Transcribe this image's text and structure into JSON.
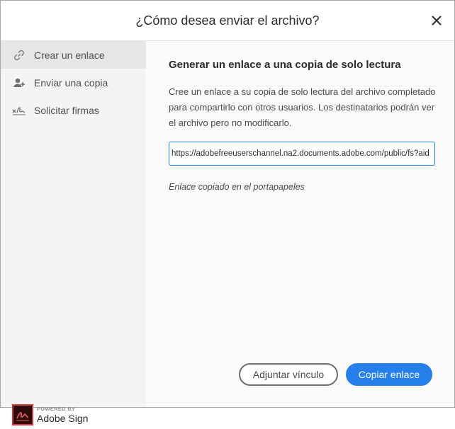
{
  "dialog": {
    "title": "¿Cómo desea enviar el archivo?",
    "close_icon": "close-icon"
  },
  "sidebar": {
    "items": [
      {
        "label": "Crear un enlace",
        "icon": "link-icon",
        "active": true
      },
      {
        "label": "Enviar una copia",
        "icon": "add-person-icon",
        "active": false
      },
      {
        "label": "Solicitar firmas",
        "icon": "signature-icon",
        "active": false
      }
    ]
  },
  "main": {
    "heading": "Generar un enlace a una copia de solo lectura",
    "description": "Cree un enlace a su copia de solo lectura del archivo completado para compartirlo con otros usuarios. Los destinatarios podrán ver el archivo pero no modificarlo.",
    "link_value": "https://adobefreeuserschannel.na2.documents.adobe.com/public/fs?aid",
    "copied_message": "Enlace copiado en el portapapeles"
  },
  "brand": {
    "powered_by": "POWERED BY",
    "name": "Adobe Sign",
    "logo_color": "#d7373f"
  },
  "buttons": {
    "attach_label": "Adjuntar vínculo",
    "copy_label": "Copiar enlace"
  },
  "colors": {
    "accent": "#2680eb",
    "sidebar_bg": "#f4f4f4",
    "sidebar_active_bg": "#e6e6e6"
  }
}
